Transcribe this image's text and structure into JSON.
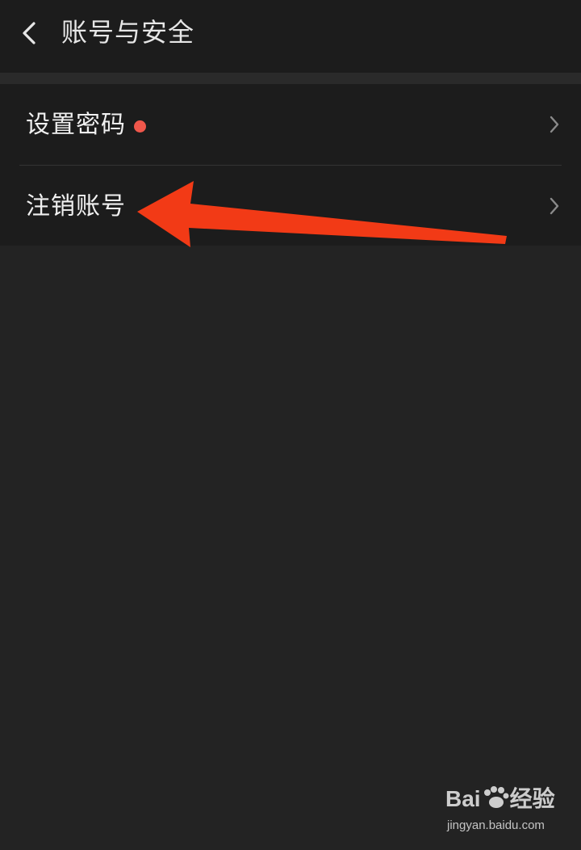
{
  "header": {
    "title": "账号与安全",
    "back_icon": "chevron-left-icon"
  },
  "settings": {
    "items": [
      {
        "label": "设置密码",
        "has_badge": true,
        "badge_color": "#f0574b",
        "icon": "chevron-right-icon"
      },
      {
        "label": "注销账号",
        "has_badge": false,
        "icon": "chevron-right-icon"
      }
    ]
  },
  "annotation": {
    "arrow_color": "#f23a16",
    "points_to": "注销账号"
  },
  "watermark": {
    "logo_text_left": "Bai",
    "logo_text_right": "经验",
    "url": "jingyan.baidu.com"
  },
  "colors": {
    "background": "#232323",
    "panel": "#1c1c1c",
    "text": "#f0f0f0"
  }
}
